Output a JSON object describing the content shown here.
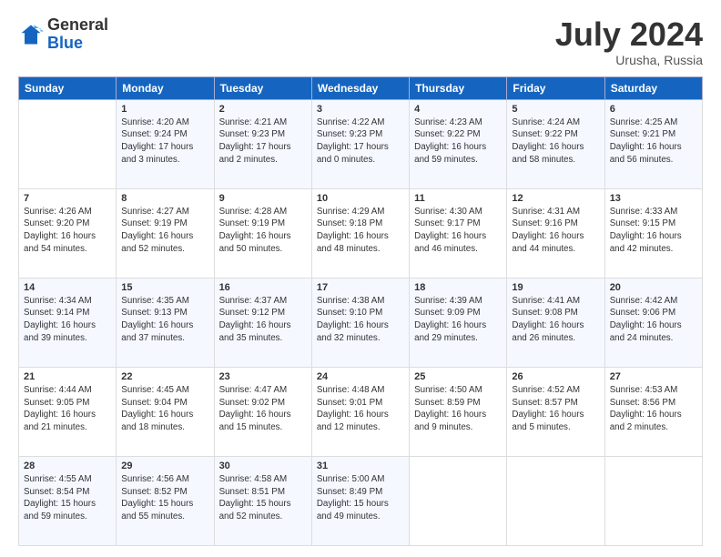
{
  "header": {
    "logo_general": "General",
    "logo_blue": "Blue",
    "month_title": "July 2024",
    "location": "Urusha, Russia"
  },
  "weekdays": [
    "Sunday",
    "Monday",
    "Tuesday",
    "Wednesday",
    "Thursday",
    "Friday",
    "Saturday"
  ],
  "weeks": [
    [
      {
        "day": "",
        "sunrise": "",
        "sunset": "",
        "daylight": ""
      },
      {
        "day": "1",
        "sunrise": "Sunrise: 4:20 AM",
        "sunset": "Sunset: 9:24 PM",
        "daylight": "Daylight: 17 hours and 3 minutes."
      },
      {
        "day": "2",
        "sunrise": "Sunrise: 4:21 AM",
        "sunset": "Sunset: 9:23 PM",
        "daylight": "Daylight: 17 hours and 2 minutes."
      },
      {
        "day": "3",
        "sunrise": "Sunrise: 4:22 AM",
        "sunset": "Sunset: 9:23 PM",
        "daylight": "Daylight: 17 hours and 0 minutes."
      },
      {
        "day": "4",
        "sunrise": "Sunrise: 4:23 AM",
        "sunset": "Sunset: 9:22 PM",
        "daylight": "Daylight: 16 hours and 59 minutes."
      },
      {
        "day": "5",
        "sunrise": "Sunrise: 4:24 AM",
        "sunset": "Sunset: 9:22 PM",
        "daylight": "Daylight: 16 hours and 58 minutes."
      },
      {
        "day": "6",
        "sunrise": "Sunrise: 4:25 AM",
        "sunset": "Sunset: 9:21 PM",
        "daylight": "Daylight: 16 hours and 56 minutes."
      }
    ],
    [
      {
        "day": "7",
        "sunrise": "Sunrise: 4:26 AM",
        "sunset": "Sunset: 9:20 PM",
        "daylight": "Daylight: 16 hours and 54 minutes."
      },
      {
        "day": "8",
        "sunrise": "Sunrise: 4:27 AM",
        "sunset": "Sunset: 9:19 PM",
        "daylight": "Daylight: 16 hours and 52 minutes."
      },
      {
        "day": "9",
        "sunrise": "Sunrise: 4:28 AM",
        "sunset": "Sunset: 9:19 PM",
        "daylight": "Daylight: 16 hours and 50 minutes."
      },
      {
        "day": "10",
        "sunrise": "Sunrise: 4:29 AM",
        "sunset": "Sunset: 9:18 PM",
        "daylight": "Daylight: 16 hours and 48 minutes."
      },
      {
        "day": "11",
        "sunrise": "Sunrise: 4:30 AM",
        "sunset": "Sunset: 9:17 PM",
        "daylight": "Daylight: 16 hours and 46 minutes."
      },
      {
        "day": "12",
        "sunrise": "Sunrise: 4:31 AM",
        "sunset": "Sunset: 9:16 PM",
        "daylight": "Daylight: 16 hours and 44 minutes."
      },
      {
        "day": "13",
        "sunrise": "Sunrise: 4:33 AM",
        "sunset": "Sunset: 9:15 PM",
        "daylight": "Daylight: 16 hours and 42 minutes."
      }
    ],
    [
      {
        "day": "14",
        "sunrise": "Sunrise: 4:34 AM",
        "sunset": "Sunset: 9:14 PM",
        "daylight": "Daylight: 16 hours and 39 minutes."
      },
      {
        "day": "15",
        "sunrise": "Sunrise: 4:35 AM",
        "sunset": "Sunset: 9:13 PM",
        "daylight": "Daylight: 16 hours and 37 minutes."
      },
      {
        "day": "16",
        "sunrise": "Sunrise: 4:37 AM",
        "sunset": "Sunset: 9:12 PM",
        "daylight": "Daylight: 16 hours and 35 minutes."
      },
      {
        "day": "17",
        "sunrise": "Sunrise: 4:38 AM",
        "sunset": "Sunset: 9:10 PM",
        "daylight": "Daylight: 16 hours and 32 minutes."
      },
      {
        "day": "18",
        "sunrise": "Sunrise: 4:39 AM",
        "sunset": "Sunset: 9:09 PM",
        "daylight": "Daylight: 16 hours and 29 minutes."
      },
      {
        "day": "19",
        "sunrise": "Sunrise: 4:41 AM",
        "sunset": "Sunset: 9:08 PM",
        "daylight": "Daylight: 16 hours and 26 minutes."
      },
      {
        "day": "20",
        "sunrise": "Sunrise: 4:42 AM",
        "sunset": "Sunset: 9:06 PM",
        "daylight": "Daylight: 16 hours and 24 minutes."
      }
    ],
    [
      {
        "day": "21",
        "sunrise": "Sunrise: 4:44 AM",
        "sunset": "Sunset: 9:05 PM",
        "daylight": "Daylight: 16 hours and 21 minutes."
      },
      {
        "day": "22",
        "sunrise": "Sunrise: 4:45 AM",
        "sunset": "Sunset: 9:04 PM",
        "daylight": "Daylight: 16 hours and 18 minutes."
      },
      {
        "day": "23",
        "sunrise": "Sunrise: 4:47 AM",
        "sunset": "Sunset: 9:02 PM",
        "daylight": "Daylight: 16 hours and 15 minutes."
      },
      {
        "day": "24",
        "sunrise": "Sunrise: 4:48 AM",
        "sunset": "Sunset: 9:01 PM",
        "daylight": "Daylight: 16 hours and 12 minutes."
      },
      {
        "day": "25",
        "sunrise": "Sunrise: 4:50 AM",
        "sunset": "Sunset: 8:59 PM",
        "daylight": "Daylight: 16 hours and 9 minutes."
      },
      {
        "day": "26",
        "sunrise": "Sunrise: 4:52 AM",
        "sunset": "Sunset: 8:57 PM",
        "daylight": "Daylight: 16 hours and 5 minutes."
      },
      {
        "day": "27",
        "sunrise": "Sunrise: 4:53 AM",
        "sunset": "Sunset: 8:56 PM",
        "daylight": "Daylight: 16 hours and 2 minutes."
      }
    ],
    [
      {
        "day": "28",
        "sunrise": "Sunrise: 4:55 AM",
        "sunset": "Sunset: 8:54 PM",
        "daylight": "Daylight: 15 hours and 59 minutes."
      },
      {
        "day": "29",
        "sunrise": "Sunrise: 4:56 AM",
        "sunset": "Sunset: 8:52 PM",
        "daylight": "Daylight: 15 hours and 55 minutes."
      },
      {
        "day": "30",
        "sunrise": "Sunrise: 4:58 AM",
        "sunset": "Sunset: 8:51 PM",
        "daylight": "Daylight: 15 hours and 52 minutes."
      },
      {
        "day": "31",
        "sunrise": "Sunrise: 5:00 AM",
        "sunset": "Sunset: 8:49 PM",
        "daylight": "Daylight: 15 hours and 49 minutes."
      },
      {
        "day": "",
        "sunrise": "",
        "sunset": "",
        "daylight": ""
      },
      {
        "day": "",
        "sunrise": "",
        "sunset": "",
        "daylight": ""
      },
      {
        "day": "",
        "sunrise": "",
        "sunset": "",
        "daylight": ""
      }
    ]
  ]
}
